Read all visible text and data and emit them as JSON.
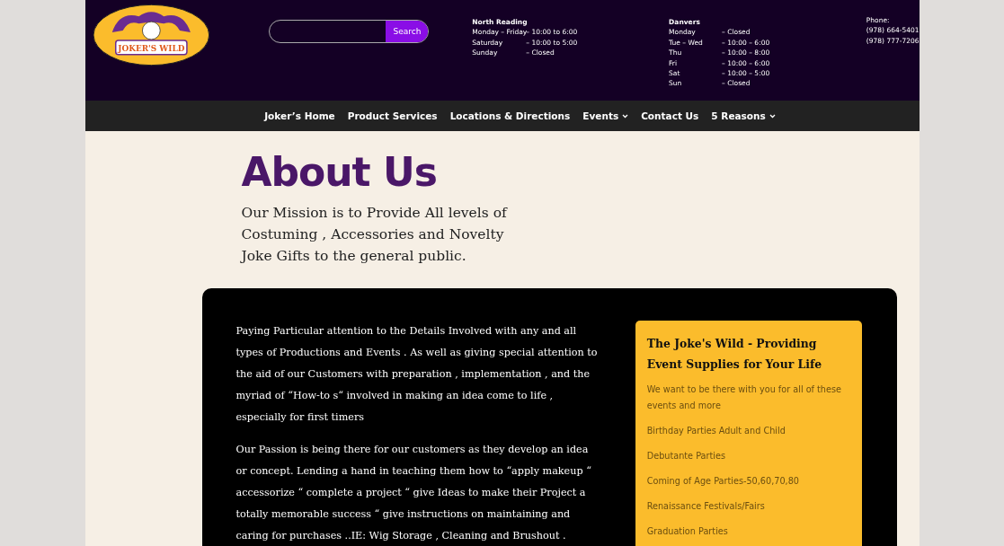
{
  "logo": {
    "text": "JOKER'S WILD"
  },
  "search": {
    "button": "Search"
  },
  "locations": [
    {
      "name": "North Reading",
      "hours": [
        {
          "day": "Monday – Friday",
          "time": "– 10:00 to 6:00"
        },
        {
          "day": "Saturday",
          "time": "– 10:00 to 5:00"
        },
        {
          "day": "Sunday",
          "time": "– Closed"
        }
      ]
    },
    {
      "name": "Danvers",
      "hours": [
        {
          "day": "Monday",
          "time": "– Closed"
        },
        {
          "day": "Tue – Wed",
          "time": "– 10:00 – 6:00"
        },
        {
          "day": "Thu",
          "time": "– 10:00 – 8:00"
        },
        {
          "day": "Fri",
          "time": "– 10:00 – 6:00"
        },
        {
          "day": "Sat",
          "time": "– 10:00 – 5:00"
        },
        {
          "day": "Sun",
          "time": "– Closed"
        }
      ]
    }
  ],
  "phone": {
    "label": "Phone:",
    "numbers": [
      "(978) 664-5401",
      "(978) 777-7206"
    ]
  },
  "nav": [
    {
      "label": "Joker’s Home",
      "dropdown": false
    },
    {
      "label": "Product Services",
      "dropdown": false
    },
    {
      "label": "Locations & Directions",
      "dropdown": false
    },
    {
      "label": "Events",
      "dropdown": true
    },
    {
      "label": "Contact Us",
      "dropdown": false
    },
    {
      "label": "5 Reasons",
      "dropdown": true
    }
  ],
  "title": "About Us",
  "mission": "Our Mission is to Provide All levels of Costuming , Accessories and Novelty Joke Gifts to the general public.",
  "paragraphs": [
    "Paying Particular attention to the Details Involved with any and all types of Productions and Events . As well as giving special attention to the aid of our Customers with preparation , implementation , and the myriad of “How-to s“ involved in making an idea come to life , especially for first timers",
    "Our Passion is being there for our customers as they develop an idea or concept. Lending a hand in teaching them how to “apply makeup “ accessorize “ complete a project “ give Ideas to make their Project a totally memorable success “ give instructions on maintaining and caring for purchases ..IE: Wig Storage , Cleaning and Brushout ."
  ],
  "sidebox": {
    "title": "The Joke's Wild - Providing Event Supplies for Your Life",
    "items": [
      "We want to be there with you for all of these events and more",
      "Birthday Parties Adult and Child",
      "Debutante Parties",
      "Coming of Age Parties-50,60,70,80",
      "Renaissance Festivals/Fairs",
      "Graduation Parties"
    ]
  }
}
